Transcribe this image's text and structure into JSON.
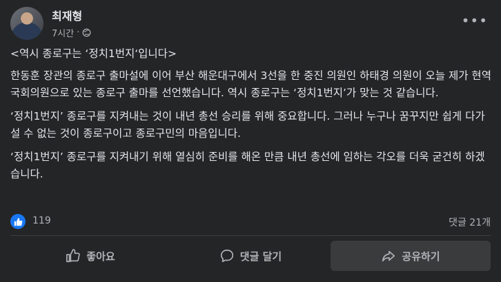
{
  "post": {
    "author": "최재형",
    "time": "7시간",
    "title": "<역시 종로구는 ‘정치1번지‘입니다>",
    "paragraphs": [
      "한동훈 장관의 종로구 출마설에 이어 부산 해운대구에서 3선을 한 중진 의원인 하태경 의원이 오늘 제가 현역 국회의원으로 있는 종로구 출마를 선언했습니다. 역시 종로구는 ‘정치1번지’가 맞는 것 같습니다.",
      "‘정치1번지’ 종로구를 지켜내는 것이 내년 총선 승리를 위해 중요합니다. 그러나 누구나 꿈꾸지만 쉽게 다가설 수 없는 것이 종로구이고 종로구민의 마음입니다.",
      "‘정치1번지’ 종로구를 지켜내기 위해 열심히 준비를 해온 만큼 내년 총선에 임하는 각오를 더욱 굳건히 하겠습니다."
    ]
  },
  "stats": {
    "likes": "119",
    "comments": "댓글 21개"
  },
  "actions": {
    "like": "좋아요",
    "comment": "댓글 달기",
    "share": "공유하기"
  },
  "icons": {
    "more": "more-options-icon",
    "audience": "globe-icon",
    "like": "thumbs-up-icon",
    "comment": "speech-bubble-icon",
    "share": "share-arrow-icon"
  },
  "colors": {
    "background": "#242526",
    "like_badge": "#1877f2",
    "text_primary": "#e4e6eb",
    "text_secondary": "#b0b3b8"
  }
}
